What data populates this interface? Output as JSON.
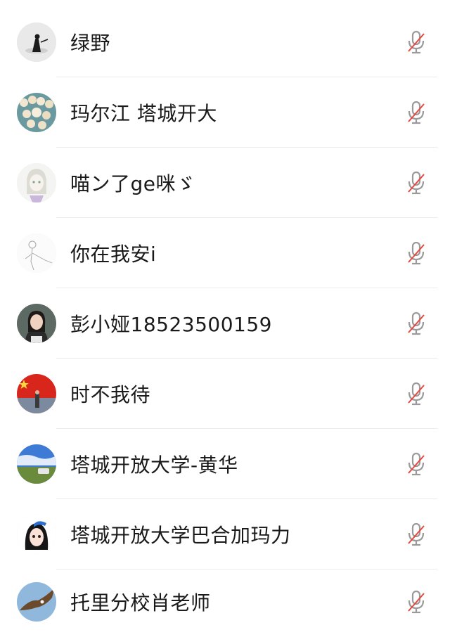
{
  "members": [
    {
      "name": "绿野",
      "avatar": "ink-figure-avatar",
      "mic": "muted"
    },
    {
      "name": "玛尔江 塔城开大",
      "avatar": "pearls-avatar",
      "mic": "muted"
    },
    {
      "name": "喵ン了ge咪ゞ",
      "avatar": "anime-girl-avatar",
      "mic": "muted"
    },
    {
      "name": "你在我安i",
      "avatar": "sketch-figure-avatar",
      "mic": "muted"
    },
    {
      "name": "彭小娅18523500159",
      "avatar": "woman-photo-avatar",
      "mic": "muted"
    },
    {
      "name": "时不我待",
      "avatar": "flag-avatar",
      "mic": "muted"
    },
    {
      "name": "塔城开放大学-黄华",
      "avatar": "landscape-avatar",
      "mic": "muted"
    },
    {
      "name": "塔城开放大学巴合加玛力",
      "avatar": "cartoon-girl-avatar",
      "mic": "muted"
    },
    {
      "name": "托里分校肖老师",
      "avatar": "eagle-avatar",
      "mic": "muted"
    }
  ],
  "colors": {
    "mic_gray": "#9a9a9a",
    "mute_slash": "#e8463f",
    "divider": "#ececec",
    "text": "#1a1a1a"
  }
}
